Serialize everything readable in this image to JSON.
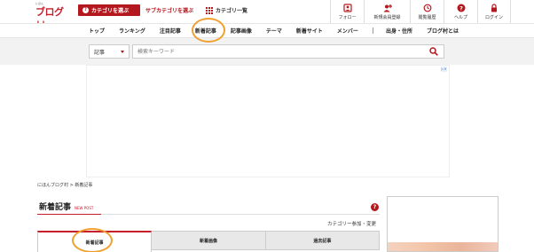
{
  "header": {
    "logo_small": "にほん",
    "logo_main": "ブログ村",
    "category_button": "カテゴリを選ぶ",
    "subcategory_button": "サブカテゴリを選ぶ",
    "category_list_button": "カテゴリ一覧",
    "icons": [
      {
        "label": "フォロー",
        "icon": "follow-icon"
      },
      {
        "label": "新規会員登録",
        "icon": "add-user-icon"
      },
      {
        "label": "閲覧履歴",
        "icon": "history-icon"
      },
      {
        "label": "ヘルプ",
        "icon": "help-icon"
      },
      {
        "label": "ログイン",
        "icon": "lock-icon"
      }
    ]
  },
  "nav": {
    "items": [
      "トップ",
      "ランキング",
      "注目記事",
      "新着記事",
      "記事画像",
      "テーマ",
      "新着サイト",
      "メンバー",
      "出身・住所",
      "ブログ村とは"
    ]
  },
  "search": {
    "select_value": "記事",
    "placeholder": "検索キーワード"
  },
  "ad": {
    "mark": "▷✕"
  },
  "breadcrumb": "にほんブログ村 > 新着記事",
  "main": {
    "title": "新着記事",
    "title_sub": "NEW POST",
    "category_link": "カテゴリー参加・変更",
    "tabs": [
      "新着記事",
      "新着画像",
      "過去記事"
    ]
  },
  "colors": {
    "brand_red": "#b3181f",
    "highlight_orange": "#f0a030"
  }
}
